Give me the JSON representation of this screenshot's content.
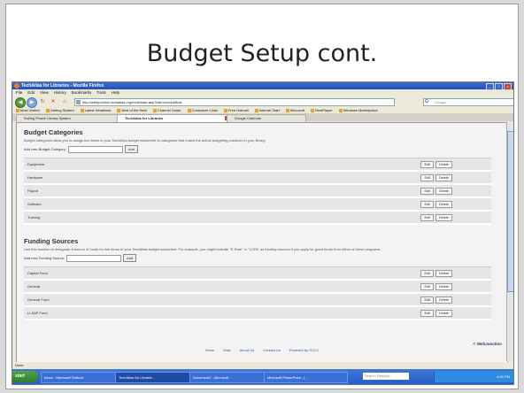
{
  "slide": {
    "title": "Budget Setup cont."
  },
  "browser": {
    "window_title": "TechAtlas for Libraries - Mozilla Firefox",
    "window_buttons": [
      "_",
      "□",
      "x"
    ],
    "menu": [
      "File",
      "Edit",
      "View",
      "History",
      "Bookmarks",
      "Tools",
      "Help"
    ],
    "url": "http://webjunction.techatlas.org/tools/start.asp?tab=checkall&all",
    "search_placeholder": "Google",
    "search_logo": "G",
    "bookmarks": [
      "Most Visited",
      "Getting Started",
      "Latest Headlines",
      "Best of the Web",
      "Channel Guide",
      "Customize Links",
      "Free Hotmail",
      "Internet Start",
      "Microsoft",
      "RealPlayer",
      "Windows Marketplace"
    ],
    "tabs": [
      {
        "label": "Rolling Prairie Library System"
      },
      {
        "label": "TechAtlas for Libraries"
      },
      {
        "label": "Google Calendar"
      }
    ],
    "status": "Done"
  },
  "page": {
    "budget": {
      "heading": "Budget Categories",
      "description": "Budget categories allow you to assign line items in your TechAtlas budget worksheet to categories that match the actual budgeting practices in your library.",
      "add_label": "Add new Budget Category:",
      "add_button": "Add",
      "items": [
        "Equipment",
        "Hardware",
        "Payroll",
        "Software",
        "Training"
      ]
    },
    "funding": {
      "heading": "Funding Sources",
      "description": "Use this function to designate a source of funds for line items in your TechAtlas budget worksheet. For example, you might indicate \"E-Rate\" or \"LSTA\" as funding sources if you apply for grant funds from either of these programs.",
      "add_label": "Add new Funding Source:",
      "add_button": "Add",
      "items": [
        "Capital Fund",
        "General",
        "General Fund",
        "LLSAP Fund"
      ]
    },
    "edit_label": "Edit",
    "delete_label": "Delete",
    "footer_links": [
      "Home",
      "Help",
      "About Us",
      "Contact Us",
      "Powered by OCLC"
    ],
    "brand": "WebJunction"
  },
  "taskbar": {
    "start": "start",
    "tasks": [
      "Inbox - Microsoft Outlook",
      "TechAtlas for Librarie...",
      "Document1 - Microsoft ...",
      "Microsoft PowerPoint - [..."
    ],
    "search_placeholder": "Search Desktop",
    "clock": "4:00 PM"
  }
}
